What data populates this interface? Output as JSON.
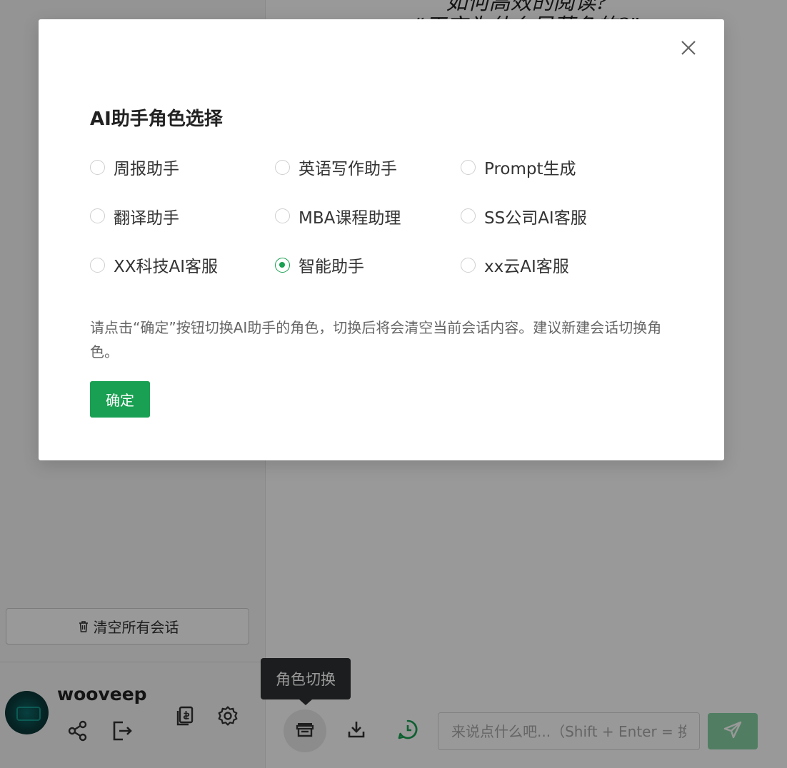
{
  "chat": {
    "header_line1": "如何高效的阅读?",
    "header_line2": "“天空为什么是蓝色的?”",
    "input_placeholder": "来说点什么吧...（Shift + Enter = 换行）"
  },
  "sidebar": {
    "clear_all_label": "清空所有会话",
    "username": "wooveep"
  },
  "tooltip": {
    "text": "角色切换"
  },
  "dialog": {
    "title": "AI助手角色选择",
    "roles": [
      [
        {
          "label": "周报助手",
          "selected": false
        },
        {
          "label": "英语写作助手",
          "selected": false
        },
        {
          "label": "Prompt生成",
          "selected": false
        }
      ],
      [
        {
          "label": "翻译助手",
          "selected": false
        },
        {
          "label": "MBA课程助理",
          "selected": false
        },
        {
          "label": "SS公司AI客服",
          "selected": false
        }
      ],
      [
        {
          "label": "XX科技AI客服",
          "selected": false
        },
        {
          "label": "智能助手",
          "selected": true
        },
        {
          "label": "xx云AI客服",
          "selected": false
        }
      ]
    ],
    "hint": "请点击“确定”按钮切换AI助手的角色，切换后将会清空当前会话内容。建议新建会话切换角色。",
    "confirm_label": "确定"
  },
  "colors": {
    "primary": "#19a052",
    "send_button": "#87d3a6",
    "tooltip_bg": "#303133",
    "overlay": "rgba(0,0,0,0.4)"
  },
  "icons": {
    "close": "close-icon",
    "trash": "trash-icon",
    "share": "share-icon",
    "logout": "logout-icon",
    "copy": "copy-document-icon",
    "settings": "gear-icon",
    "role_switch": "store-icon",
    "download": "download-icon",
    "history": "whatsapp-clock-icon",
    "send": "send-icon"
  }
}
